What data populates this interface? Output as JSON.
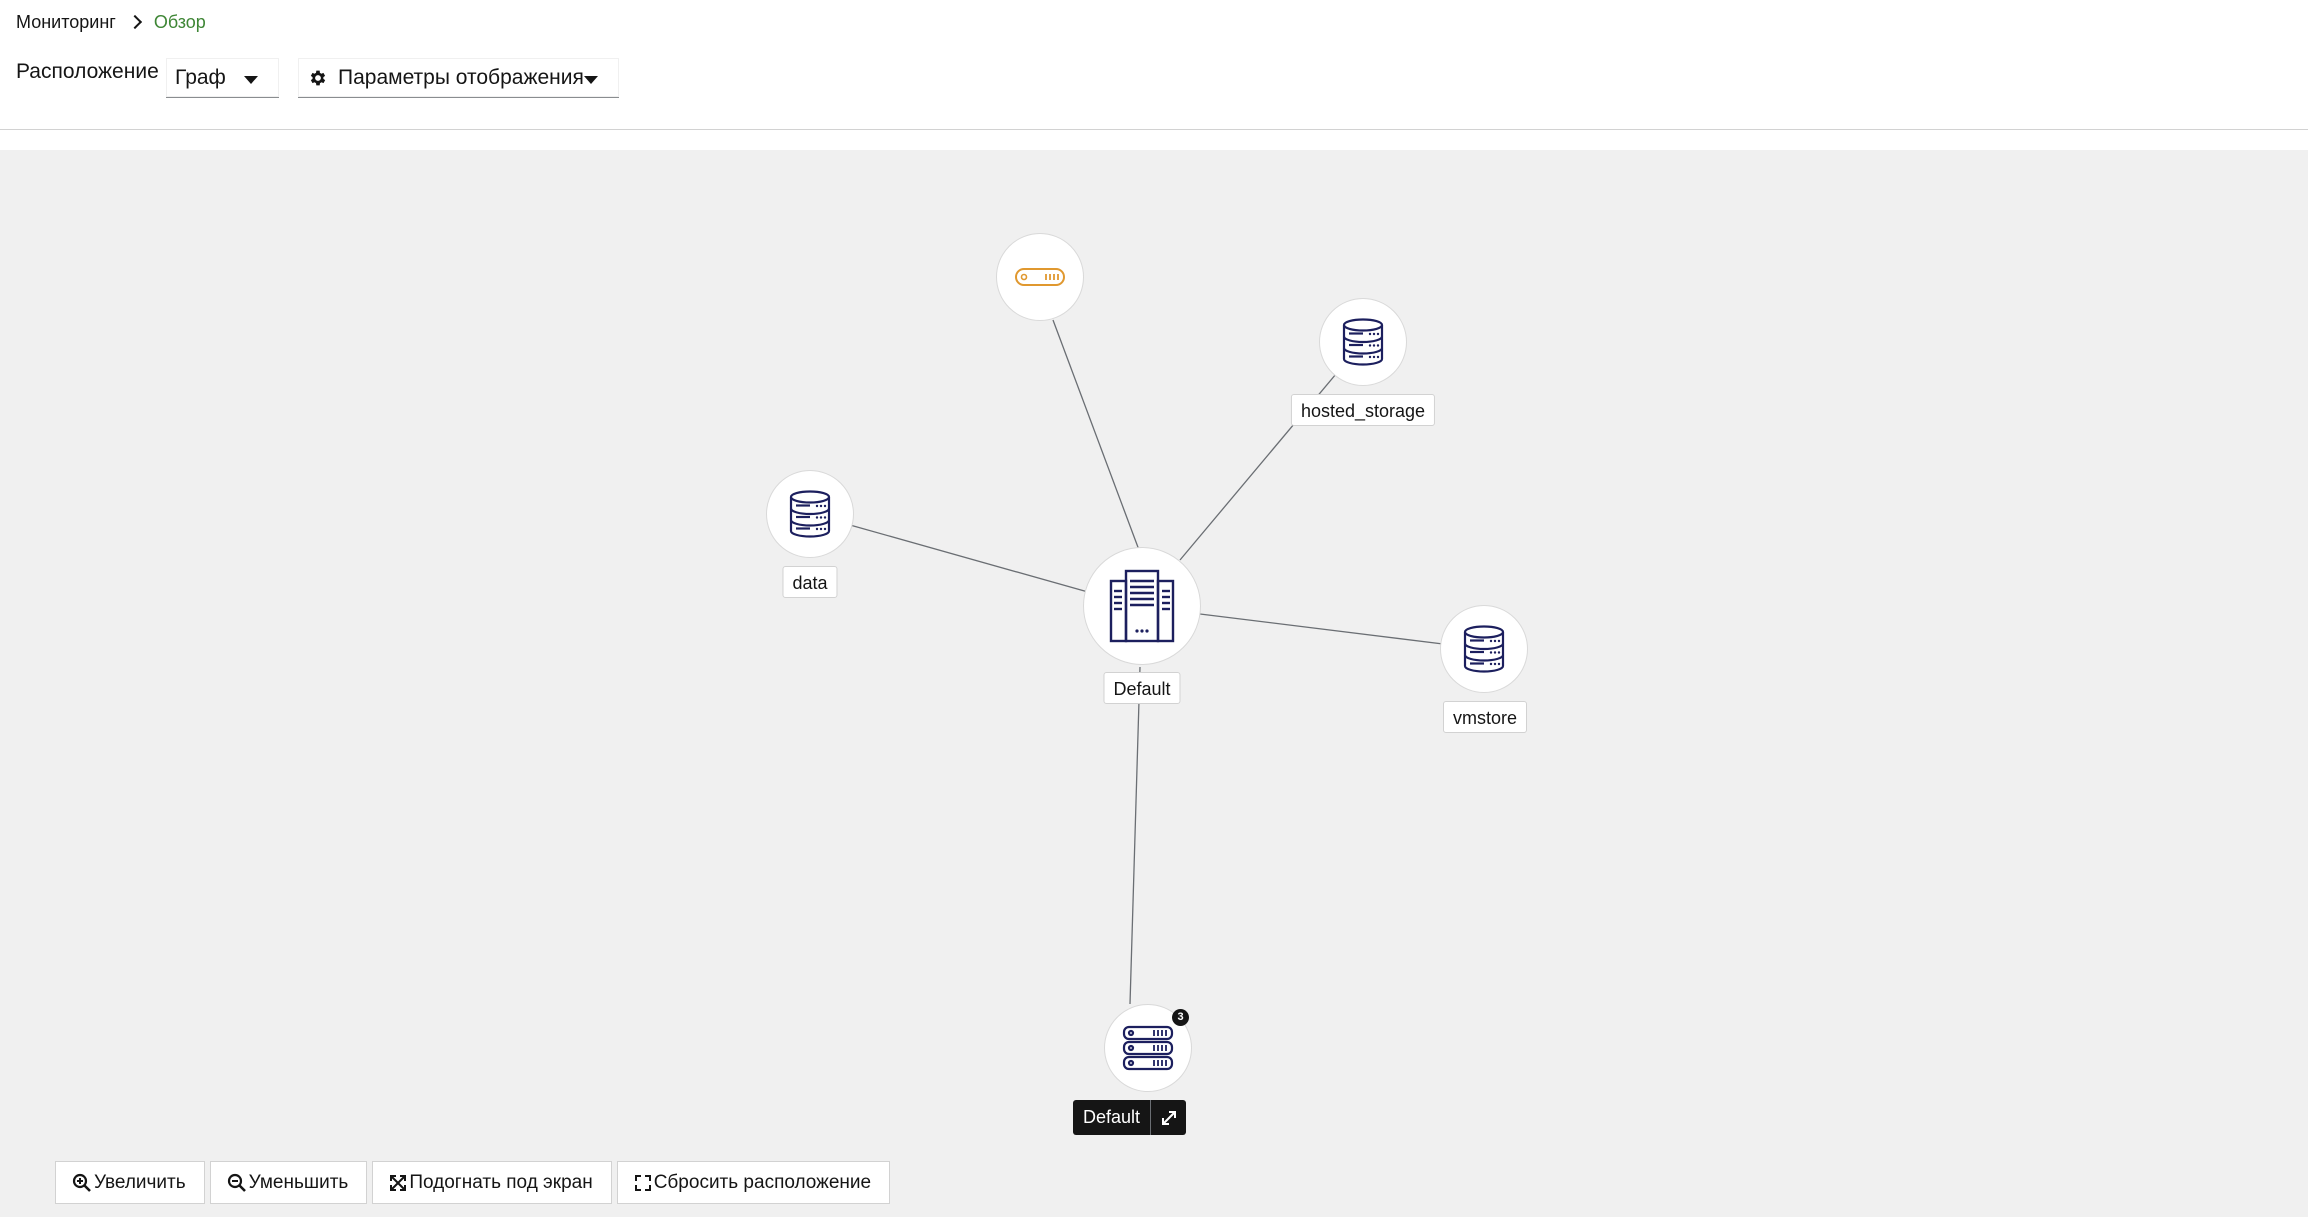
{
  "breadcrumb": {
    "parent": "Мониторинг",
    "current": "Обзор"
  },
  "toolbar": {
    "layout_label": "Расположение",
    "layout_value": "Граф",
    "display_params_label": "Параметры отображения"
  },
  "graph": {
    "center_label": "Default",
    "nodes": {
      "network": {
        "icon": "network-device-icon",
        "label": ""
      },
      "hosted_storage": {
        "icon": "storage-domain-icon",
        "label": "hosted_storage"
      },
      "data": {
        "icon": "storage-domain-icon",
        "label": "data"
      },
      "vmstore": {
        "icon": "storage-domain-icon",
        "label": "vmstore"
      },
      "cluster": {
        "icon": "server-stack-icon",
        "label": "Default",
        "badge": "3"
      }
    },
    "colors": {
      "icon_navy": "#1c1f5e",
      "icon_orange": "#e0982f",
      "edge": "#6a6e73"
    }
  },
  "zoom_controls": {
    "zoom_in": "Увеличить",
    "zoom_out": "Уменьшить",
    "fit": "Подогнать под экран",
    "reset": "Сбросить расположение"
  }
}
